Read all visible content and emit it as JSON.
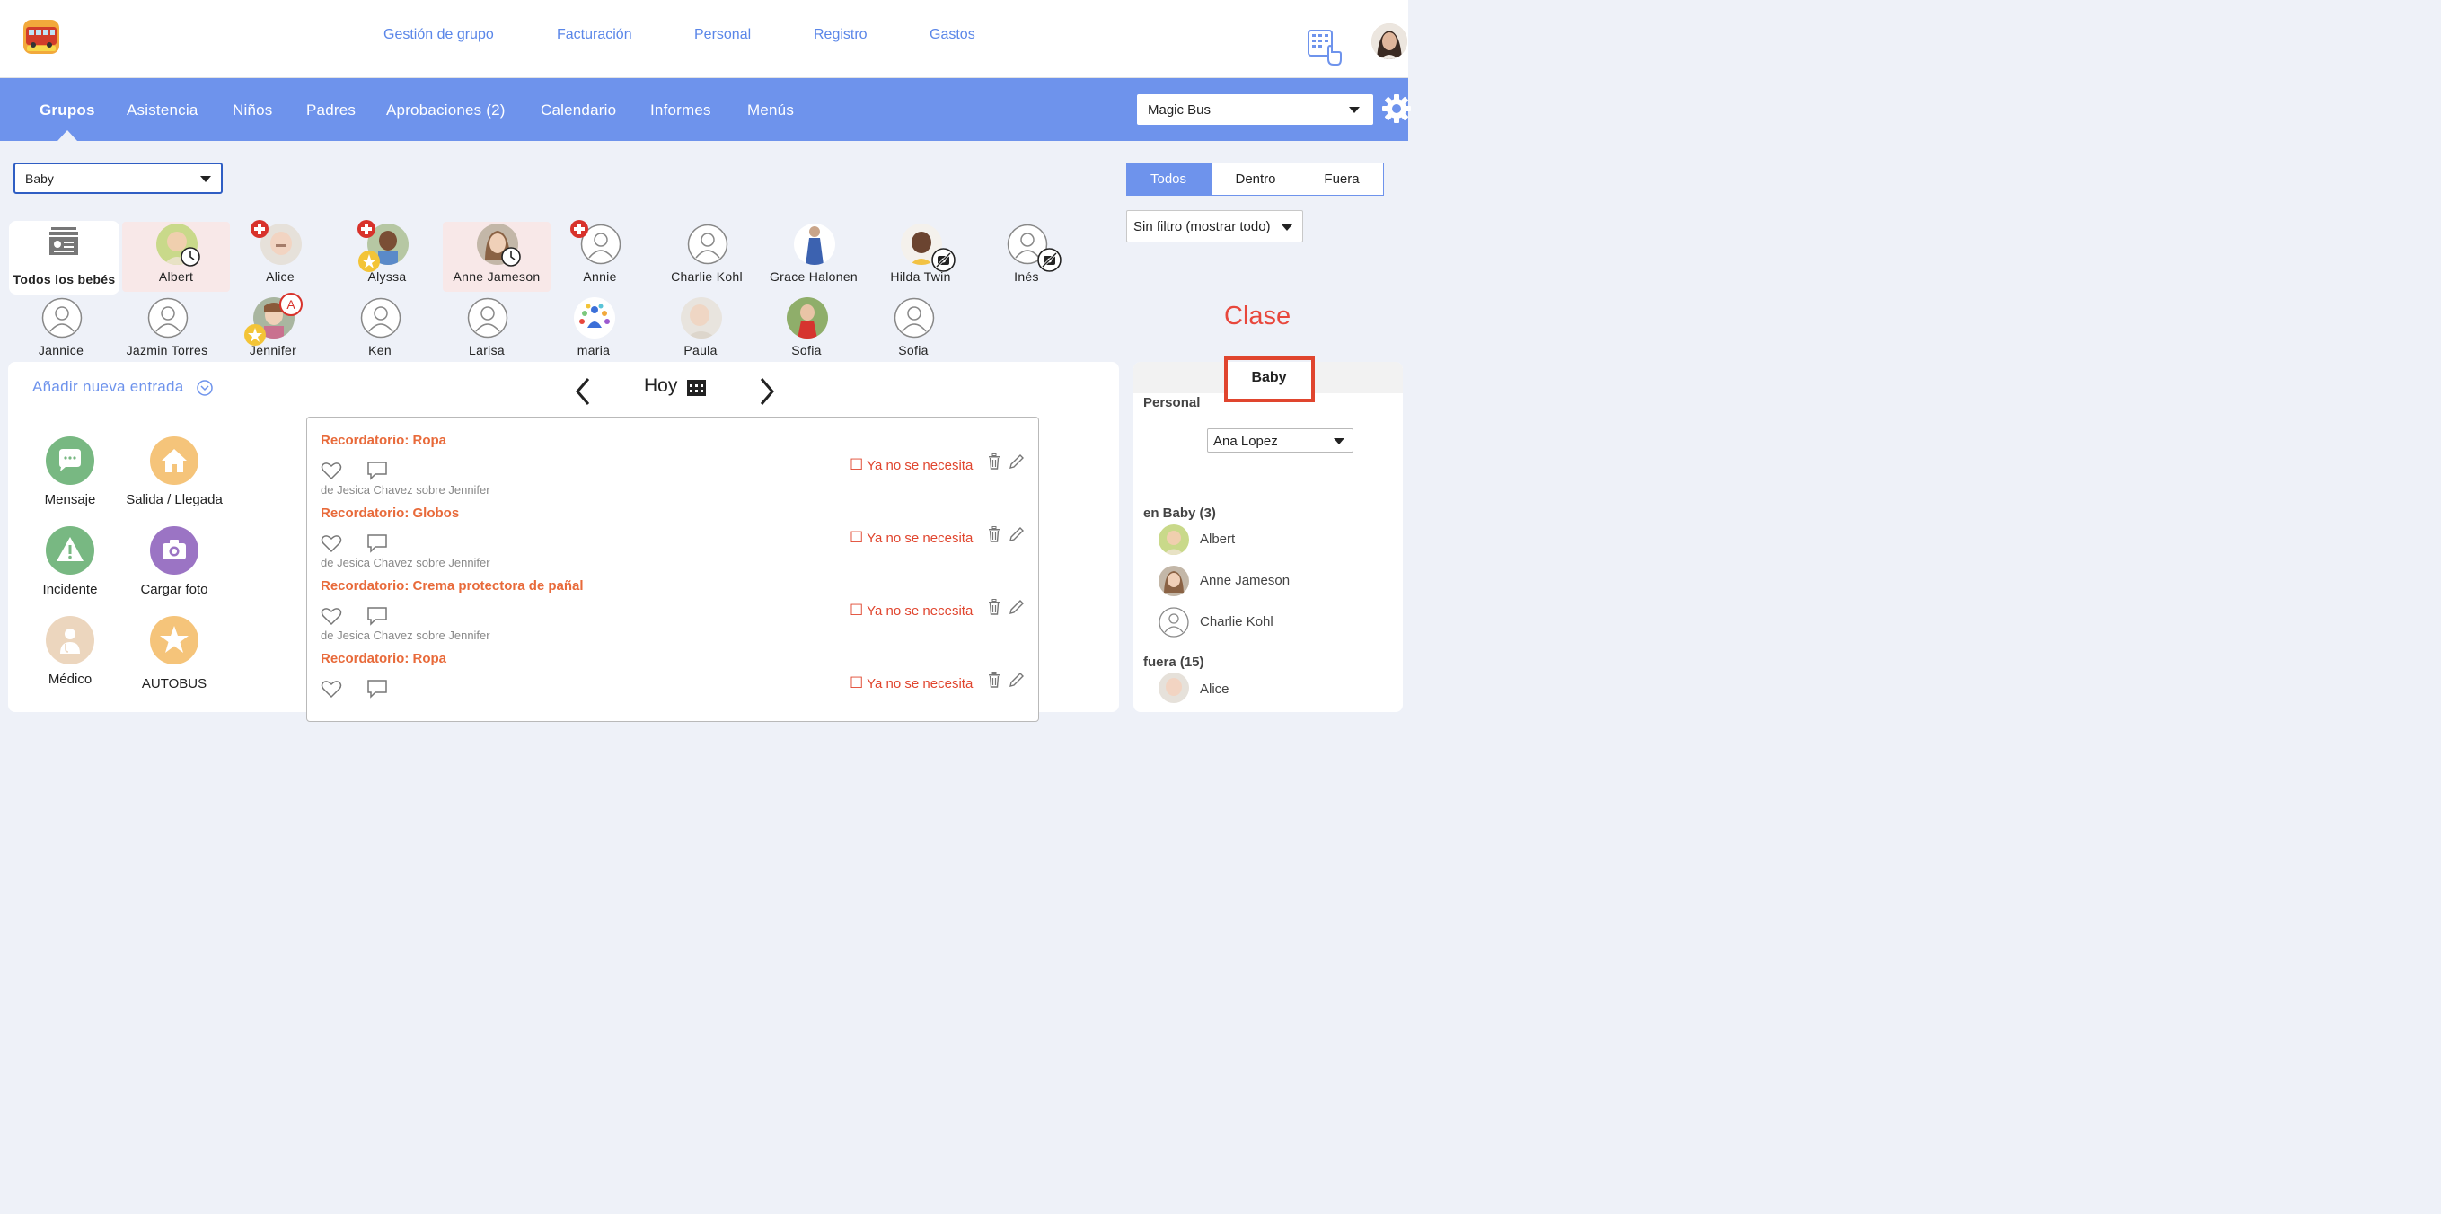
{
  "topnav": {
    "links": [
      "Gestión de grupo",
      "Facturación",
      "Personal",
      "Registro",
      "Gastos"
    ]
  },
  "mainnav": {
    "tabs": [
      "Grupos",
      "Asistencia",
      "Niños",
      "Padres",
      "Aprobaciones (2)",
      "Calendario",
      "Informes",
      "Menús"
    ],
    "school_select": "Magic Bus"
  },
  "group_select": "Baby",
  "filters": {
    "segments": [
      "Todos",
      "Dentro",
      "Fuera"
    ],
    "active_segment": "Todos",
    "filter_select": "Sin filtro (mostrar todo)"
  },
  "clase_label": "Clase",
  "children": {
    "all_label": "Todos los bebés",
    "row1": [
      "Albert",
      "Alice",
      "Alyssa",
      "Anne Jameson",
      "Annie",
      "Charlie Kohl",
      "Grace Halonen",
      "Hilda Twin",
      "Inés"
    ],
    "row2": [
      "Jannice",
      "Jazmin Torres",
      "Jennifer",
      "Ken",
      "Larisa",
      "maria",
      "Paula",
      "Sofia",
      "Sofia"
    ],
    "jennifer_badge": "A"
  },
  "feed": {
    "add_entry": "Añadir nueva entrada",
    "date_label": "Hoy",
    "actions": [
      "Mensaje",
      "Salida / Llegada",
      "Incidente",
      "Cargar foto",
      "Médico",
      "AUTOBUS"
    ],
    "entries": [
      {
        "title": "Recordatorio: Ropa",
        "author": "de Jesica Chavez sobre Jennifer",
        "status": "Ya no se necesita"
      },
      {
        "title": "Recordatorio: Globos",
        "author": "de Jesica Chavez sobre Jennifer",
        "status": "Ya no se necesita"
      },
      {
        "title": "Recordatorio: Crema protectora de pañal",
        "author": "de Jesica Chavez sobre Jennifer",
        "status": "Ya no se necesita"
      },
      {
        "title": "Recordatorio: Ropa",
        "author": "",
        "status": "Ya no se necesita"
      }
    ]
  },
  "staff_panel": {
    "tab": "Baby",
    "personal_label": "Personal",
    "staff_select": "Ana Lopez",
    "in_label": "en Baby (3)",
    "in_children": [
      "Albert",
      "Anne Jameson",
      "Charlie Kohl"
    ],
    "out_label": "fuera (15)",
    "out_children": [
      "Alice"
    ]
  },
  "colors": {
    "accent": "#6e93ec",
    "reminder": "#e86a3a",
    "alert_red": "#e0452e"
  }
}
